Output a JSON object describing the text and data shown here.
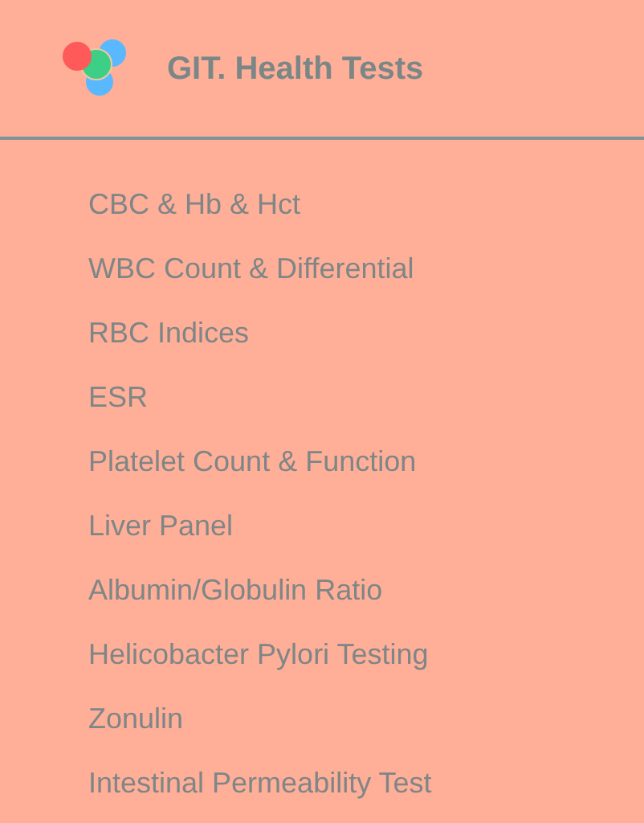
{
  "header": {
    "title": "GIT. Health Tests"
  },
  "items": [
    "CBC & Hb & Hct",
    "WBC Count & Differential",
    "RBC Indices",
    "ESR",
    "Platelet Count & Function",
    "Liver Panel",
    "Albumin/Globulin Ratio",
    "Helicobacter Pylori Testing",
    "Zonulin",
    "Intestinal Permeability Test"
  ]
}
